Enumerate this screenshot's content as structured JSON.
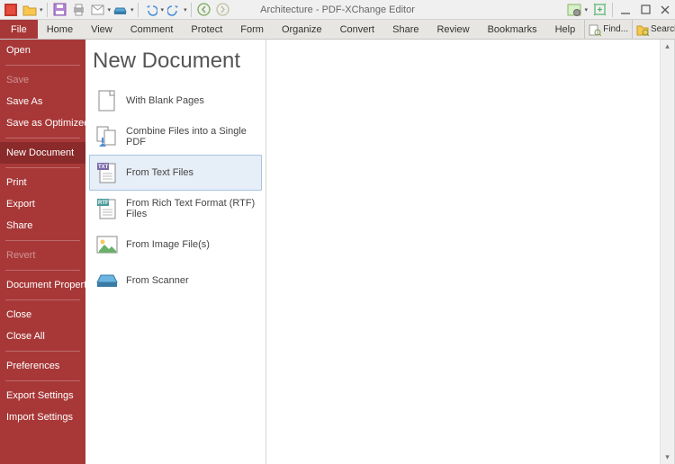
{
  "titlebar": {
    "title": "Architecture - PDF-XChange Editor"
  },
  "menubar": {
    "file": "File",
    "items": [
      "Home",
      "View",
      "Comment",
      "Protect",
      "Form",
      "Organize",
      "Convert",
      "Share",
      "Review",
      "Bookmarks",
      "Help"
    ],
    "find": "Find...",
    "search": "Search..."
  },
  "sidebar": {
    "open": "Open",
    "save": "Save",
    "saveAs": "Save As",
    "saveOpt": "Save as Optimized",
    "newDoc": "New Document",
    "print": "Print",
    "export": "Export",
    "share": "Share",
    "revert": "Revert",
    "docProps": "Document Properties",
    "close": "Close",
    "closeAll": "Close All",
    "prefs": "Preferences",
    "exportSettings": "Export Settings",
    "importSettings": "Import Settings"
  },
  "main": {
    "heading": "New Document",
    "opts": {
      "blank": "With Blank Pages",
      "combine": "Combine Files into a Single PDF",
      "text": "From Text Files",
      "rtf": "From Rich Text Format (RTF) Files",
      "image": "From Image File(s)",
      "scanner": "From Scanner"
    }
  }
}
